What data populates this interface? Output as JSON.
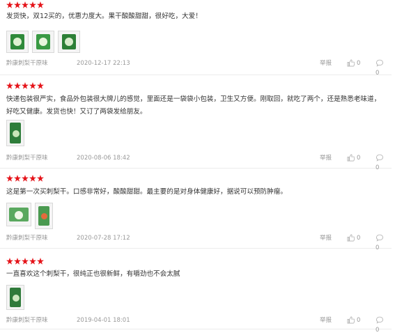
{
  "colors": {
    "star": "#e5141a",
    "meta_text": "#999999",
    "body_text": "#333333",
    "divider": "#ececec"
  },
  "reviews": [
    {
      "rating": 5,
      "text": "发货快，双12买的，优惠力度大。果干酸酸甜甜，很好吃，大爱！",
      "images": [
        "product-photo-green-bag",
        "product-photo-green-bag",
        "product-photo-green-bag"
      ],
      "variant": "黔康刺梨干原味",
      "date": "2020-12-17 22:13",
      "report_label": "举报",
      "likes": "0",
      "replies": "0"
    },
    {
      "rating": 5,
      "text": "快递包装很严实，食品外包装很大牌儿的感觉，里面还是一袋袋小包装，卫生又方便。刚取回，就吃了两个，还是熟悉老味道，好吃又健康。发货也快！又订了两袋发给朋友。",
      "images": [
        "product-photo-package"
      ],
      "variant": "黔康刺梨干原味",
      "date": "2020-08-06 18:42",
      "report_label": "举报",
      "likes": "0",
      "replies": "0"
    },
    {
      "rating": 5,
      "text": "这是第一次买刺梨干。口感非常好，酸酸甜甜。最主要的是对身体健康好，据说可以预防肿瘤。",
      "images": [
        "product-photo-open-bag",
        "product-photo-package"
      ],
      "variant": "黔康刺梨干原味",
      "date": "2020-07-28 17:12",
      "report_label": "举报",
      "likes": "0",
      "replies": "0"
    },
    {
      "rating": 5,
      "text": "一直喜欢这个刺梨干，很纯正也很新鲜，有嚼劲也不会太腻",
      "images": [
        "product-photo-package"
      ],
      "variant": "黔康刺梨干原味",
      "date": "2019-04-01 18:01",
      "report_label": "举报",
      "likes": "0",
      "replies": "0"
    }
  ]
}
